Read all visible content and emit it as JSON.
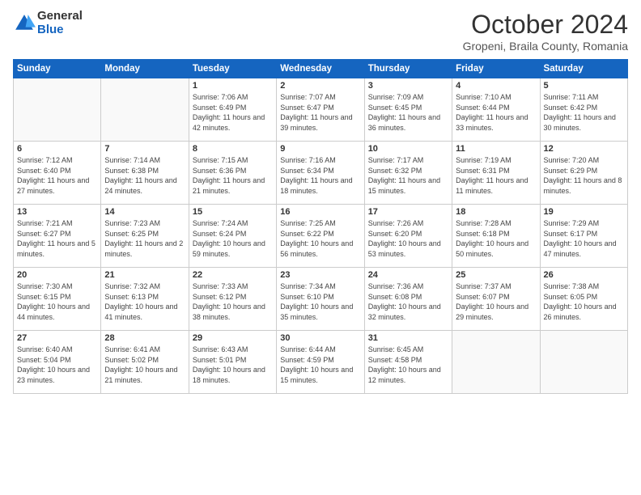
{
  "header": {
    "logo_general": "General",
    "logo_blue": "Blue",
    "month_title": "October 2024",
    "subtitle": "Gropeni, Braila County, Romania"
  },
  "days_of_week": [
    "Sunday",
    "Monday",
    "Tuesday",
    "Wednesday",
    "Thursday",
    "Friday",
    "Saturday"
  ],
  "weeks": [
    [
      {
        "day": "",
        "info": ""
      },
      {
        "day": "",
        "info": ""
      },
      {
        "day": "1",
        "info": "Sunrise: 7:06 AM\nSunset: 6:49 PM\nDaylight: 11 hours and 42 minutes."
      },
      {
        "day": "2",
        "info": "Sunrise: 7:07 AM\nSunset: 6:47 PM\nDaylight: 11 hours and 39 minutes."
      },
      {
        "day": "3",
        "info": "Sunrise: 7:09 AM\nSunset: 6:45 PM\nDaylight: 11 hours and 36 minutes."
      },
      {
        "day": "4",
        "info": "Sunrise: 7:10 AM\nSunset: 6:44 PM\nDaylight: 11 hours and 33 minutes."
      },
      {
        "day": "5",
        "info": "Sunrise: 7:11 AM\nSunset: 6:42 PM\nDaylight: 11 hours and 30 minutes."
      }
    ],
    [
      {
        "day": "6",
        "info": "Sunrise: 7:12 AM\nSunset: 6:40 PM\nDaylight: 11 hours and 27 minutes."
      },
      {
        "day": "7",
        "info": "Sunrise: 7:14 AM\nSunset: 6:38 PM\nDaylight: 11 hours and 24 minutes."
      },
      {
        "day": "8",
        "info": "Sunrise: 7:15 AM\nSunset: 6:36 PM\nDaylight: 11 hours and 21 minutes."
      },
      {
        "day": "9",
        "info": "Sunrise: 7:16 AM\nSunset: 6:34 PM\nDaylight: 11 hours and 18 minutes."
      },
      {
        "day": "10",
        "info": "Sunrise: 7:17 AM\nSunset: 6:32 PM\nDaylight: 11 hours and 15 minutes."
      },
      {
        "day": "11",
        "info": "Sunrise: 7:19 AM\nSunset: 6:31 PM\nDaylight: 11 hours and 11 minutes."
      },
      {
        "day": "12",
        "info": "Sunrise: 7:20 AM\nSunset: 6:29 PM\nDaylight: 11 hours and 8 minutes."
      }
    ],
    [
      {
        "day": "13",
        "info": "Sunrise: 7:21 AM\nSunset: 6:27 PM\nDaylight: 11 hours and 5 minutes."
      },
      {
        "day": "14",
        "info": "Sunrise: 7:23 AM\nSunset: 6:25 PM\nDaylight: 11 hours and 2 minutes."
      },
      {
        "day": "15",
        "info": "Sunrise: 7:24 AM\nSunset: 6:24 PM\nDaylight: 10 hours and 59 minutes."
      },
      {
        "day": "16",
        "info": "Sunrise: 7:25 AM\nSunset: 6:22 PM\nDaylight: 10 hours and 56 minutes."
      },
      {
        "day": "17",
        "info": "Sunrise: 7:26 AM\nSunset: 6:20 PM\nDaylight: 10 hours and 53 minutes."
      },
      {
        "day": "18",
        "info": "Sunrise: 7:28 AM\nSunset: 6:18 PM\nDaylight: 10 hours and 50 minutes."
      },
      {
        "day": "19",
        "info": "Sunrise: 7:29 AM\nSunset: 6:17 PM\nDaylight: 10 hours and 47 minutes."
      }
    ],
    [
      {
        "day": "20",
        "info": "Sunrise: 7:30 AM\nSunset: 6:15 PM\nDaylight: 10 hours and 44 minutes."
      },
      {
        "day": "21",
        "info": "Sunrise: 7:32 AM\nSunset: 6:13 PM\nDaylight: 10 hours and 41 minutes."
      },
      {
        "day": "22",
        "info": "Sunrise: 7:33 AM\nSunset: 6:12 PM\nDaylight: 10 hours and 38 minutes."
      },
      {
        "day": "23",
        "info": "Sunrise: 7:34 AM\nSunset: 6:10 PM\nDaylight: 10 hours and 35 minutes."
      },
      {
        "day": "24",
        "info": "Sunrise: 7:36 AM\nSunset: 6:08 PM\nDaylight: 10 hours and 32 minutes."
      },
      {
        "day": "25",
        "info": "Sunrise: 7:37 AM\nSunset: 6:07 PM\nDaylight: 10 hours and 29 minutes."
      },
      {
        "day": "26",
        "info": "Sunrise: 7:38 AM\nSunset: 6:05 PM\nDaylight: 10 hours and 26 minutes."
      }
    ],
    [
      {
        "day": "27",
        "info": "Sunrise: 6:40 AM\nSunset: 5:04 PM\nDaylight: 10 hours and 23 minutes."
      },
      {
        "day": "28",
        "info": "Sunrise: 6:41 AM\nSunset: 5:02 PM\nDaylight: 10 hours and 21 minutes."
      },
      {
        "day": "29",
        "info": "Sunrise: 6:43 AM\nSunset: 5:01 PM\nDaylight: 10 hours and 18 minutes."
      },
      {
        "day": "30",
        "info": "Sunrise: 6:44 AM\nSunset: 4:59 PM\nDaylight: 10 hours and 15 minutes."
      },
      {
        "day": "31",
        "info": "Sunrise: 6:45 AM\nSunset: 4:58 PM\nDaylight: 10 hours and 12 minutes."
      },
      {
        "day": "",
        "info": ""
      },
      {
        "day": "",
        "info": ""
      }
    ]
  ]
}
